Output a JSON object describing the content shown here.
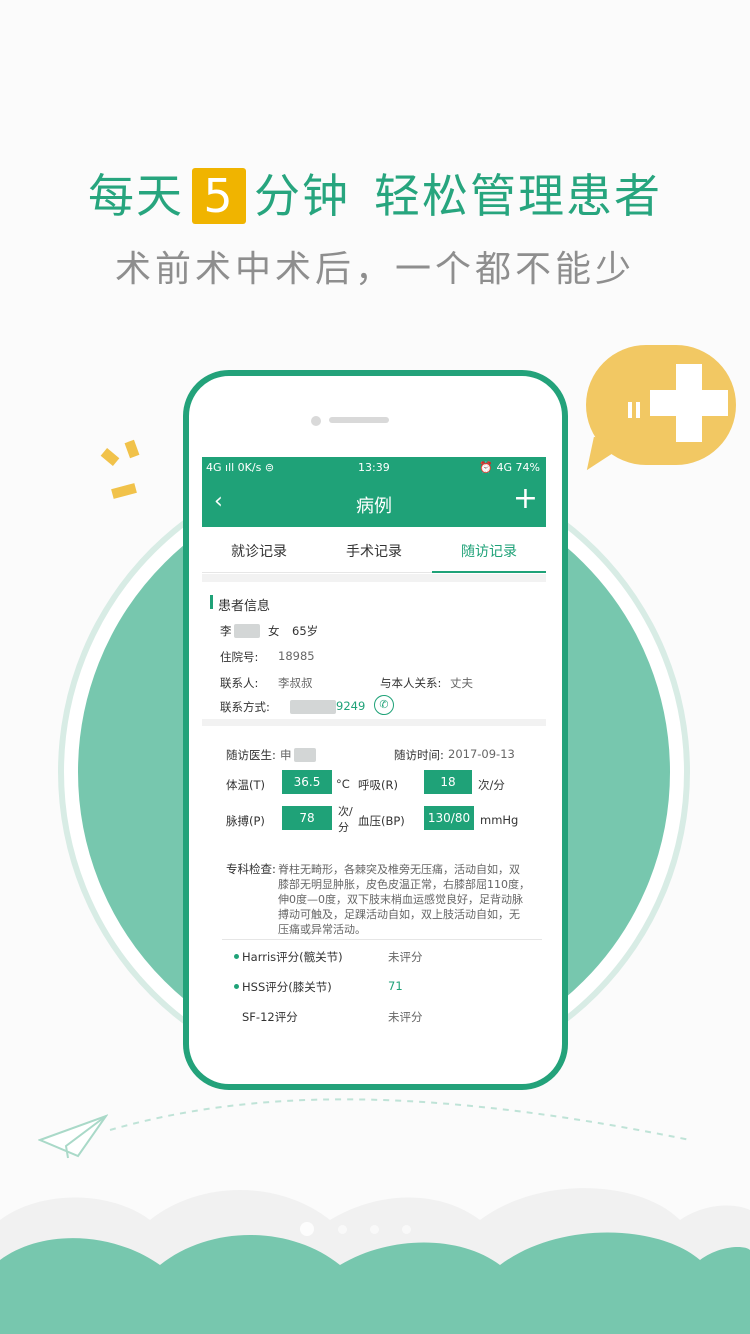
{
  "headline": {
    "part1": "每天",
    "highlight": "5",
    "part2": "分钟",
    "part3": "轻松管理患者"
  },
  "subline": "术前术中术后，一个都不能少",
  "colors": {
    "brand_green": "#1fa278",
    "accent_yellow": "#f0b400",
    "circle_bg": "#77c7ae",
    "bubble_yellow": "#f2c863"
  },
  "status_bar": {
    "left": "4G ıll  0K/s ⊜",
    "time": "13:39",
    "right": "⏰ 4G 74%"
  },
  "nav": {
    "back_icon": "back-icon",
    "title": "病例",
    "add_icon": "plus-icon"
  },
  "tabs": [
    {
      "label": "就诊记录",
      "active": false
    },
    {
      "label": "手术记录",
      "active": false
    },
    {
      "label": "随访记录",
      "active": true
    }
  ],
  "patient": {
    "section_title": "患者信息",
    "surname": "李",
    "gender": "女",
    "age": "65岁",
    "admission_label": "住院号:",
    "admission_no": "18985",
    "contact_label": "联系人:",
    "contact_name": "李叔叔",
    "relation_label": "与本人关系:",
    "relation": "丈夫",
    "phone_label": "联系方式:",
    "phone_tail": "9249"
  },
  "followup": {
    "doctor_label": "随访医生:",
    "doctor_surname": "申",
    "time_label": "随访时间:",
    "time": "2017-09-13",
    "temp_label": "体温(T)",
    "temp": "36.5",
    "temp_unit": "°C",
    "resp_label": "呼吸(R)",
    "resp": "18",
    "resp_unit": "次/分",
    "pulse_label": "脉搏(P)",
    "pulse": "78",
    "pulse_unit_1": "次/",
    "pulse_unit_2": "分",
    "bp_label": "血压(BP)",
    "bp": "130/80",
    "bp_unit": "mmHg",
    "exam_label": "专科检查:",
    "exam_lines": [
      "脊柱无畸形，各棘突及椎旁无压痛，活动自如，双",
      "膝部无明显肿胀，皮色皮温正常，右膝部屈110度，",
      "伸0度—0度，双下肢末梢血运感觉良好，足背动脉",
      "搏动可触及，足踝活动自如，双上肢活动自如，无",
      "压痛或异常活动。"
    ]
  },
  "scores": [
    {
      "name": "Harris评分(髋关节)",
      "value": "未评分"
    },
    {
      "name": "HSS评分(膝关节)",
      "value": "71"
    },
    {
      "name": "SF-12评分",
      "value": "未评分"
    }
  ]
}
